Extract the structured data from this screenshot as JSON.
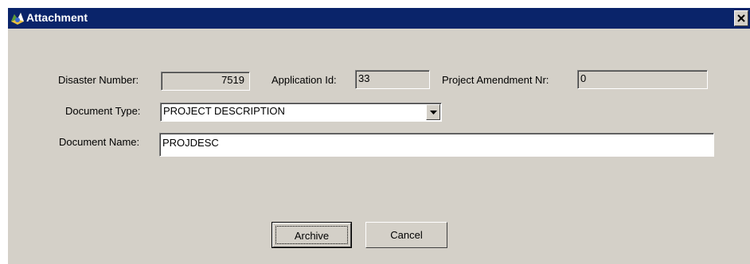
{
  "window": {
    "title": "Attachment",
    "icon": "app-icon",
    "close_icon": "close-icon"
  },
  "form": {
    "disaster_number_label": "Disaster Number:",
    "disaster_number_value": "7519",
    "application_id_label": "Application Id:",
    "application_id_value": "33",
    "project_amendment_label": "Project Amendment Nr:",
    "project_amendment_value": "0",
    "document_type_label": "Document Type:",
    "document_type_value": "PROJECT DESCRIPTION",
    "document_name_label": "Document Name:",
    "document_name_value": "PROJDESC"
  },
  "buttons": {
    "archive_label": "Archive",
    "cancel_label": "Cancel"
  },
  "colors": {
    "titlebar": "#0a246a",
    "window_bg": "#d4d0c8"
  }
}
